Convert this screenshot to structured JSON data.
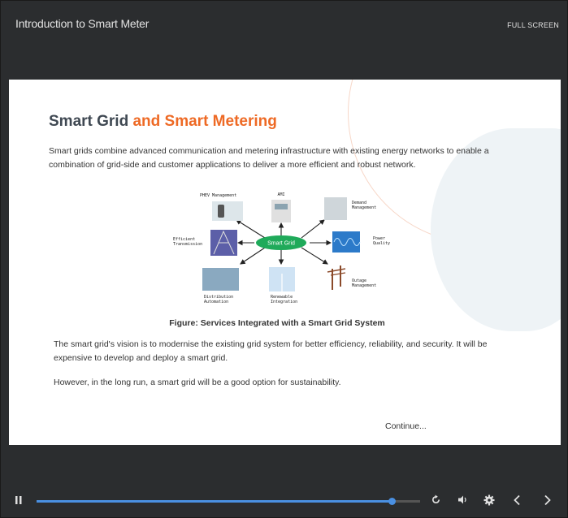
{
  "header": {
    "title": "Introduction to Smart Meter",
    "fullscreen_label": "FULL SCREEN"
  },
  "slide": {
    "heading_part1": "Smart Grid",
    "heading_part2": "and Smart Metering",
    "paragraph1": "Smart grids combine advanced communication and metering infrastructure with existing energy networks to enable a combination of grid-side and customer applications to deliver a more efficient and robust network.",
    "diagram": {
      "center": "Smart Grid",
      "nodes": {
        "phev": [
          "PHEV Management"
        ],
        "ami": [
          "AMI"
        ],
        "demand": [
          "Demand",
          "Management"
        ],
        "transmission": [
          "Efficient",
          "Transmission"
        ],
        "power_quality": [
          "Power",
          "Quality"
        ],
        "distribution": [
          "Distribution",
          "Automation"
        ],
        "renewable": [
          "Renewable",
          "Integration"
        ],
        "outage": [
          "Outage",
          "Management"
        ]
      }
    },
    "caption": "Figure: Services Integrated with a Smart Grid System",
    "paragraph2": "The smart grid's vision is to modernise the existing grid system for better efficiency, reliability, and security. It will be expensive to develop and deploy a smart grid.",
    "paragraph3": "However, in the long run, a smart grid will be a good option for sustainability.",
    "continue_label": "Continue..."
  },
  "player": {
    "progress_fraction": 0.925,
    "accent_color": "#4a90e2",
    "icons": [
      "pause-icon",
      "replay-icon",
      "volume-icon",
      "settings-icon",
      "prev-icon",
      "next-icon"
    ]
  }
}
